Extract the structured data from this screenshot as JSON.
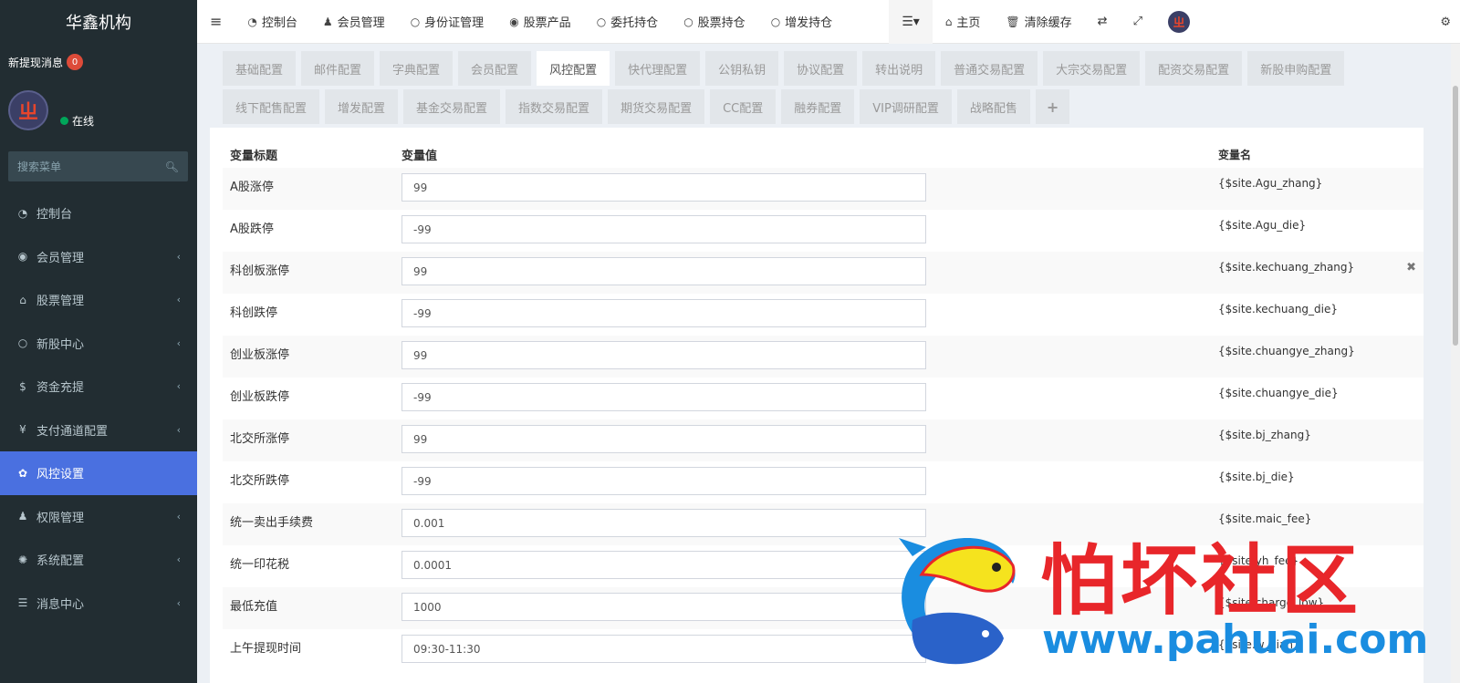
{
  "sidebar": {
    "brand": "华鑫机构",
    "notice_label": "新提现消息",
    "notice_count": "0",
    "avatar_glyph": "ㄓ",
    "status": "在线",
    "search_placeholder": "搜索菜单",
    "items": [
      {
        "icon": "dashboard-icon",
        "glyph": "◔",
        "label": "控制台",
        "chevron": ""
      },
      {
        "icon": "user-circle-icon",
        "glyph": "◉",
        "label": "会员管理",
        "chevron": "‹"
      },
      {
        "icon": "bank-icon",
        "glyph": "⌂",
        "label": "股票管理",
        "chevron": "‹"
      },
      {
        "icon": "circle-icon",
        "glyph": "○",
        "label": "新股中心",
        "chevron": "‹"
      },
      {
        "icon": "dollar-icon",
        "glyph": "$",
        "label": "资金充提",
        "chevron": "‹"
      },
      {
        "icon": "yen-icon",
        "glyph": "¥",
        "label": "支付通道配置",
        "chevron": "‹"
      },
      {
        "icon": "gear-icon",
        "glyph": "✿",
        "label": "风控设置",
        "chevron": ""
      },
      {
        "icon": "users-icon",
        "glyph": "♟",
        "label": "权限管理",
        "chevron": "‹"
      },
      {
        "icon": "cog-icon",
        "glyph": "✺",
        "label": "系统配置",
        "chevron": "‹"
      },
      {
        "icon": "list-icon",
        "glyph": "☰",
        "label": "消息中心",
        "chevron": "‹"
      }
    ],
    "active_index": 6
  },
  "topbar": {
    "nav": [
      {
        "icon": "dashboard-icon",
        "glyph": "◔",
        "label": "控制台"
      },
      {
        "icon": "user-icon",
        "glyph": "♟",
        "label": "会员管理"
      },
      {
        "icon": "circle-icon",
        "glyph": "○",
        "label": "身份证管理"
      },
      {
        "icon": "dot-circle-icon",
        "glyph": "◉",
        "label": "股票产品"
      },
      {
        "icon": "circle-icon",
        "glyph": "○",
        "label": "委托持仓"
      },
      {
        "icon": "circle-icon",
        "glyph": "○",
        "label": "股票持仓"
      },
      {
        "icon": "circle-icon",
        "glyph": "○",
        "label": "增发持仓"
      }
    ],
    "home_label": "主页",
    "clear_cache_label": "清除缓存"
  },
  "tabs": [
    "基础配置",
    "邮件配置",
    "字典配置",
    "会员配置",
    "风控配置",
    "快代理配置",
    "公钥私钥",
    "协议配置",
    "转出说明",
    "普通交易配置",
    "大宗交易配置",
    "配资交易配置",
    "新股申购配置",
    "线下配售配置",
    "增发配置",
    "基金交易配置",
    "指数交易配置",
    "期货交易配置",
    "CC配置",
    "融券配置",
    "VIP调研配置",
    "战略配售"
  ],
  "active_tab": 4,
  "table": {
    "headers": {
      "title": "变量标题",
      "value": "变量值",
      "name": "变量名"
    },
    "rows": [
      {
        "title": "A股涨停",
        "value": "99",
        "name": "{$site.Agu_zhang}"
      },
      {
        "title": "A股跌停",
        "value": "-99",
        "name": "{$site.Agu_die}"
      },
      {
        "title": "科创板涨停",
        "value": "99",
        "name": "{$site.kechuang_zhang}"
      },
      {
        "title": "科创跌停",
        "value": "-99",
        "name": "{$site.kechuang_die}"
      },
      {
        "title": "创业板涨停",
        "value": "99",
        "name": "{$site.chuangye_zhang}"
      },
      {
        "title": "创业板跌停",
        "value": "-99",
        "name": "{$site.chuangye_die}"
      },
      {
        "title": "北交所涨停",
        "value": "99",
        "name": "{$site.bj_zhang}"
      },
      {
        "title": "北交所跌停",
        "value": "-99",
        "name": "{$site.bj_die}"
      },
      {
        "title": "统一卖出手续费",
        "value": "0.001",
        "name": "{$site.maic_fee}"
      },
      {
        "title": "统一印花税",
        "value": "0.0001",
        "name": "{$site.yh_fee}"
      },
      {
        "title": "最低充值",
        "value": "1000",
        "name": "{$site.charge_low}"
      },
      {
        "title": "上午提现时间",
        "value": "09:30-11:30",
        "name": "{$site.w_xian}"
      }
    ]
  },
  "watermark": {
    "title": "怕坏社区",
    "url": "www.pahuai.com"
  },
  "colors": {
    "sidebar_bg": "#222d32",
    "active_menu": "#4a70e0",
    "badge": "#dd4b39",
    "online": "#00a65a"
  }
}
